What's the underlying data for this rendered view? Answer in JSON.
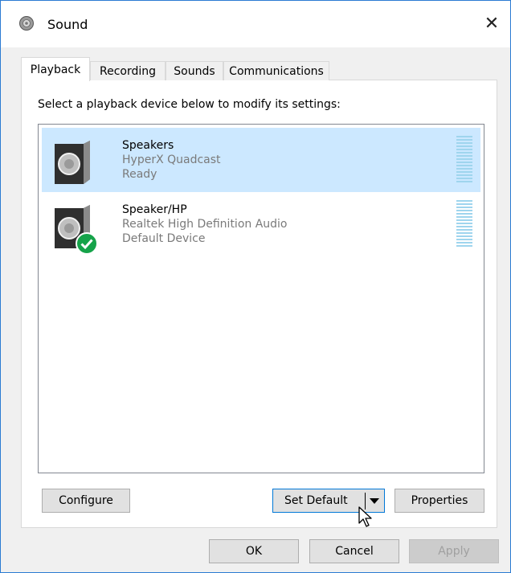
{
  "window": {
    "title": "Sound",
    "close_label": "✕"
  },
  "tabs": [
    {
      "label": "Playback",
      "active": true
    },
    {
      "label": "Recording",
      "active": false
    },
    {
      "label": "Sounds",
      "active": false
    },
    {
      "label": "Communications",
      "active": false
    }
  ],
  "instruction": "Select a playback device below to modify its settings:",
  "devices": [
    {
      "name": "Speakers",
      "description": "HyperX Quadcast",
      "status": "Ready",
      "selected": true,
      "is_default": false,
      "icon": "speaker-icon"
    },
    {
      "name": "Speaker/HP",
      "description": "Realtek High Definition Audio",
      "status": "Default Device",
      "selected": false,
      "is_default": true,
      "icon": "speaker-icon"
    }
  ],
  "buttons": {
    "configure": "Configure",
    "set_default": "Set Default",
    "properties": "Properties",
    "ok": "OK",
    "cancel": "Cancel",
    "apply": "Apply"
  },
  "colors": {
    "selection": "#cce8ff",
    "meter": "#9fd5ee",
    "default_badge": "#16a34a",
    "window_border": "#2b7bd3"
  }
}
